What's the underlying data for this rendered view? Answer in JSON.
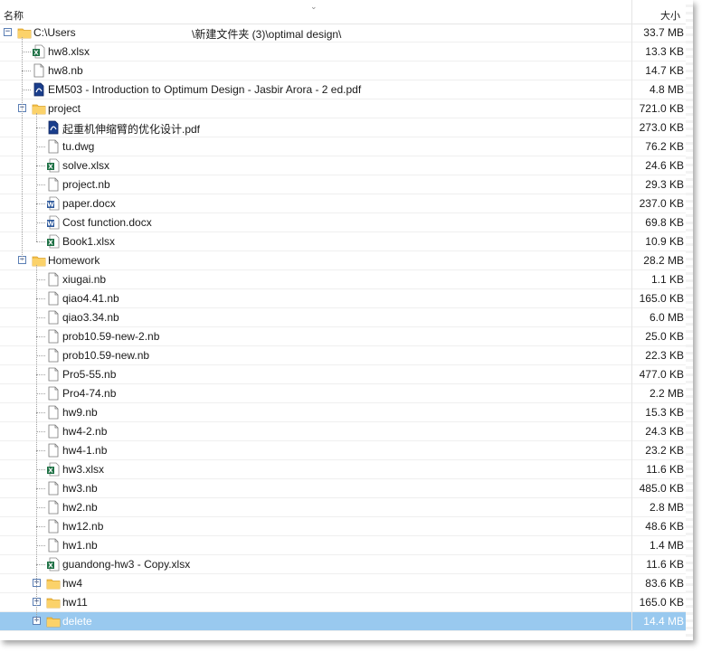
{
  "columns": {
    "name": "名称",
    "size": "大小"
  },
  "rows": [
    {
      "label": "C:\\Users",
      "label_tail": "\\新建文件夹 (3)\\optimal design\\",
      "size": "33.7 MB",
      "type": "folder",
      "depth": 0,
      "expander": "−"
    },
    {
      "label": "hw8.xlsx",
      "size": "13.3 KB",
      "type": "xlsx",
      "depth": 1
    },
    {
      "label": "hw8.nb",
      "size": "14.7 KB",
      "type": "nb",
      "depth": 1
    },
    {
      "label": "EM503 - Introduction to Optimum Design - Jasbir Arora - 2 ed.pdf",
      "size": "4.8 MB",
      "type": "pdf",
      "depth": 1
    },
    {
      "label": "project",
      "size": "721.0 KB",
      "type": "folder",
      "depth": 1,
      "expander": "−"
    },
    {
      "label": "起重机伸缩臂的优化设计.pdf",
      "size": "273.0 KB",
      "type": "pdf",
      "depth": 2
    },
    {
      "label": "tu.dwg",
      "size": "76.2 KB",
      "type": "nb",
      "depth": 2
    },
    {
      "label": "solve.xlsx",
      "size": "24.6 KB",
      "type": "xlsx",
      "depth": 2
    },
    {
      "label": "project.nb",
      "size": "29.3 KB",
      "type": "nb",
      "depth": 2
    },
    {
      "label": "paper.docx",
      "size": "237.0 KB",
      "type": "docx",
      "depth": 2
    },
    {
      "label": "Cost function.docx",
      "size": "69.8 KB",
      "type": "docx",
      "depth": 2
    },
    {
      "label": "Book1.xlsx",
      "size": "10.9 KB",
      "type": "xlsx",
      "depth": 2
    },
    {
      "label": "Homework",
      "size": "28.2 MB",
      "type": "folder",
      "depth": 1,
      "expander": "−"
    },
    {
      "label": "xiugai.nb",
      "size": "1.1 KB",
      "type": "nb",
      "depth": 2
    },
    {
      "label": "qiao4.41.nb",
      "size": "165.0 KB",
      "type": "nb",
      "depth": 2
    },
    {
      "label": "qiao3.34.nb",
      "size": "6.0 MB",
      "type": "nb",
      "depth": 2
    },
    {
      "label": "prob10.59-new-2.nb",
      "size": "25.0 KB",
      "type": "nb",
      "depth": 2
    },
    {
      "label": "prob10.59-new.nb",
      "size": "22.3 KB",
      "type": "nb",
      "depth": 2
    },
    {
      "label": "Pro5-55.nb",
      "size": "477.0 KB",
      "type": "nb",
      "depth": 2
    },
    {
      "label": "Pro4-74.nb",
      "size": "2.2 MB",
      "type": "nb",
      "depth": 2
    },
    {
      "label": "hw9.nb",
      "size": "15.3 KB",
      "type": "nb",
      "depth": 2
    },
    {
      "label": "hw4-2.nb",
      "size": "24.3 KB",
      "type": "nb",
      "depth": 2
    },
    {
      "label": "hw4-1.nb",
      "size": "23.2 KB",
      "type": "nb",
      "depth": 2
    },
    {
      "label": "hw3.xlsx",
      "size": "11.6 KB",
      "type": "xlsx",
      "depth": 2
    },
    {
      "label": "hw3.nb",
      "size": "485.0 KB",
      "type": "nb",
      "depth": 2
    },
    {
      "label": "hw2.nb",
      "size": "2.8 MB",
      "type": "nb",
      "depth": 2
    },
    {
      "label": "hw12.nb",
      "size": "48.6 KB",
      "type": "nb",
      "depth": 2
    },
    {
      "label": "hw1.nb",
      "size": "1.4 MB",
      "type": "nb",
      "depth": 2
    },
    {
      "label": "guandong-hw3 - Copy.xlsx",
      "size": "11.6 KB",
      "type": "xlsx",
      "depth": 2
    },
    {
      "label": "hw4",
      "size": "83.6 KB",
      "type": "folder",
      "depth": 2,
      "expander": "+"
    },
    {
      "label": "hw11",
      "size": "165.0 KB",
      "type": "folder",
      "depth": 2,
      "expander": "+"
    },
    {
      "label": "delete",
      "size": "14.4 MB",
      "type": "folder",
      "depth": 2,
      "expander": "+",
      "selected": true
    }
  ],
  "colors": {
    "folder": "#f5c04a",
    "xlsx": "#1e7145",
    "docx": "#2b579a",
    "pdf": "#1a3e8c",
    "selection": "#99c9ef"
  }
}
